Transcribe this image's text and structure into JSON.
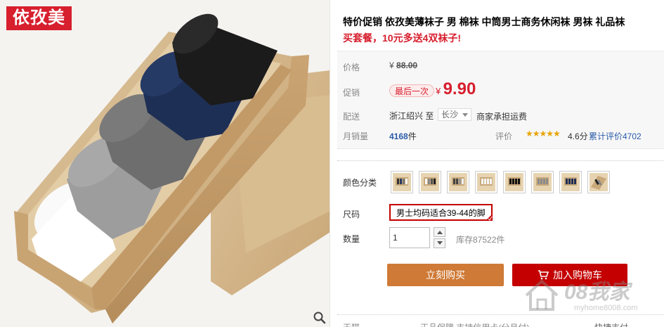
{
  "brand": {
    "logo_text": "依孜美"
  },
  "product": {
    "title": "特价促销 依孜美薄袜子 男 棉袜 中筒男士商务休闲袜 男袜 礼品袜",
    "promo_text": "买套餐，10元多送4双袜子!"
  },
  "price": {
    "label": "价格",
    "currency": "¥",
    "original": "88.00",
    "promo_label": "促销",
    "promo_badge": "最后一次",
    "promo_currency": "¥",
    "promo_value": "9.90"
  },
  "shipping": {
    "label": "配送",
    "from": "浙江绍兴  至",
    "to": "长沙",
    "note": "商家承担运费"
  },
  "sales": {
    "label": "月销量",
    "count": "4168",
    "unit": "件",
    "rating_label": "评价",
    "stars": "★★★★★",
    "rating_score": "4.6分",
    "review_text": "累计评价4702"
  },
  "options": {
    "color_label": "颜色分类",
    "size_label": "尺码",
    "size_value": "男士均码适合39-44的脚",
    "quantity_label": "数量",
    "quantity_value": "1",
    "stock_text": "库存87522件"
  },
  "actions": {
    "buy_now": "立刻购买",
    "add_cart": "加入购物车"
  },
  "watermark": {
    "text": "08我家",
    "url": "myhome8008.com"
  },
  "bottom": {
    "label": "天猫",
    "text": "正品保障  支持信用卡(分月付)",
    "right": "快捷支付"
  },
  "colors": {
    "accent_red": "#c40000",
    "buy_orange": "#cf7a36",
    "link_blue": "#2a5ba9"
  }
}
